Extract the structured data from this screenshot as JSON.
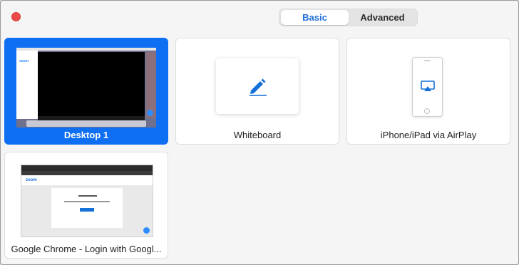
{
  "tabs": {
    "basic": "Basic",
    "advanced": "Advanced"
  },
  "tiles": [
    {
      "label": "Desktop 1",
      "selected": true
    },
    {
      "label": "Whiteboard"
    },
    {
      "label": "iPhone/iPad via AirPlay"
    },
    {
      "label": "Google Chrome - Login with Googl..."
    }
  ],
  "colors": {
    "accent": "#0e6ff2",
    "close": "#ec4a46"
  },
  "icons": {
    "whiteboard": "pencil-icon",
    "airplay": "airplay-icon"
  }
}
